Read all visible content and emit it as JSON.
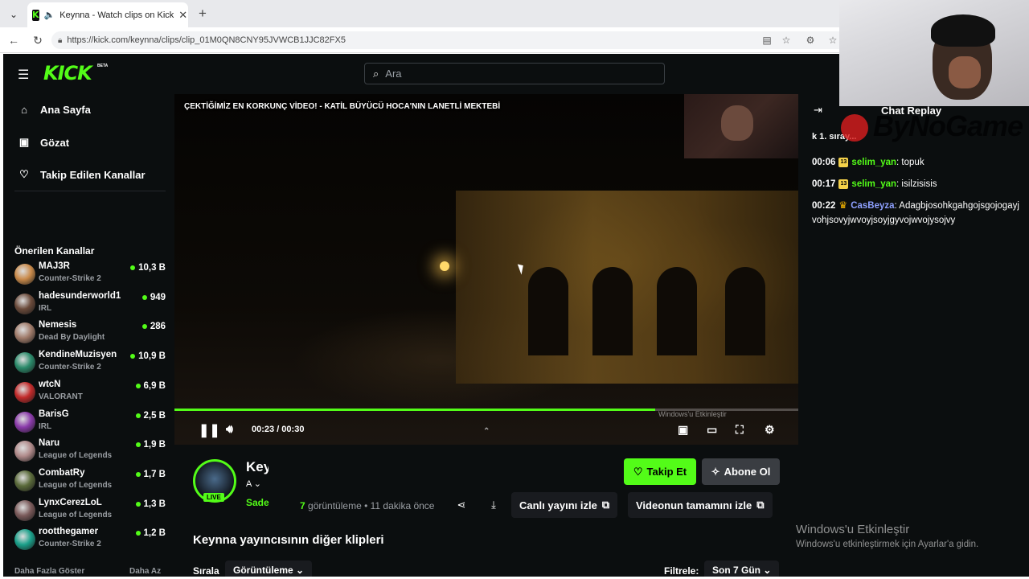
{
  "browser": {
    "tab_title": "Keynna - Watch clips on Kick",
    "url": "https://kick.com/keynna/clips/clip_01M0QN8CNY95JVWCB1JJC82FX5"
  },
  "header": {
    "logo": "KICK",
    "beta": "BETA",
    "search_placeholder": "Ara"
  },
  "sidebar": {
    "nav": [
      {
        "label": "Ana Sayfa",
        "icon": "home-icon"
      },
      {
        "label": "Gözat",
        "icon": "browse-icon"
      },
      {
        "label": "Takip Edilen Kanallar",
        "icon": "heart-icon"
      }
    ],
    "recommended_title": "Önerilen Kanallar",
    "channels": [
      {
        "name": "MAJ3R",
        "category": "Counter-Strike 2",
        "viewers": "10,3 B",
        "color": "#c98a4a"
      },
      {
        "name": "hadesunderworld1",
        "category": "IRL",
        "viewers": "949",
        "color": "#6a4a3a"
      },
      {
        "name": "Nemesis",
        "category": "Dead By Daylight",
        "viewers": "286",
        "color": "#a07b6a"
      },
      {
        "name": "KendineMuzisyen",
        "category": "Counter-Strike 2",
        "viewers": "10,9 B",
        "color": "#2a8a6a"
      },
      {
        "name": "wtcN",
        "category": "VALORANT",
        "viewers": "6,9 B",
        "color": "#c22a2a"
      },
      {
        "name": "BarisG",
        "category": "IRL",
        "viewers": "2,5 B",
        "color": "#8a3aaa"
      },
      {
        "name": "Naru",
        "category": "League of Legends",
        "viewers": "1,9 B",
        "color": "#b08a8a"
      },
      {
        "name": "CombatRy",
        "category": "League of Legends",
        "viewers": "1,7 B",
        "color": "#5a6a3a"
      },
      {
        "name": "LynxCerezLoL",
        "category": "League of Legends",
        "viewers": "1,3 B",
        "color": "#7a5a5a"
      },
      {
        "name": "rootthegamer",
        "category": "Counter-Strike 2",
        "viewers": "1,2 B",
        "color": "#1aa08a"
      }
    ],
    "show_more": "Daha Fazla Göster",
    "show_less": "Daha Az"
  },
  "video": {
    "overlay_title": "ÇEKTİĞİMİZ EN KORKUNÇ VİDEO! - KATİL BÜYÜCÜ HOCA'NIN LANETLİ MEKTEBİ",
    "time": "00:23 / 00:30",
    "progress": 0.77,
    "small_watermark": "Windows'u Etkinleştir"
  },
  "streamer": {
    "name": "Keynna",
    "sub": "A",
    "category": "Sade",
    "live": "LIVE",
    "views_count": "7",
    "views_label": "görüntüleme",
    "time_ago": "11 dakika önce",
    "follow": "Takip Et",
    "subscribe": "Abone Ol",
    "watch_live": "Canlı yayını izle",
    "watch_full": "Videonun tamamını izle"
  },
  "clips": {
    "title": "Keynna yayıncısının diğer klipleri",
    "sort_label": "Sırala",
    "sort_value": "Görüntüleme",
    "filter_label": "Filtrele:",
    "filter_value": "Son 7 Gün"
  },
  "chat": {
    "title": "Chat Replay",
    "pinned": "k 1. sıray... ",
    "messages": [
      {
        "time": "00:06",
        "user": "selim_yan",
        "text": ": topuk",
        "badge": "13",
        "style": "u1"
      },
      {
        "time": "00:17",
        "user": "selim_yan",
        "text": ": isilzisisis",
        "badge": "13",
        "style": "u1"
      },
      {
        "time": "00:22",
        "user": "CasBeyza",
        "text": ": Adagbjosohkgahgojsgojogayjvohjsovyjwvoyjsoyjgyvojwvojysojvy",
        "badge": "crown",
        "style": "u2"
      }
    ]
  },
  "overlays": {
    "brand": "ByNoGame",
    "windows_activate": "Windows'u Etkinleştir",
    "windows_activate_sub": "Windows'u etkinleştirmek için Ayarlar'a gidin."
  }
}
